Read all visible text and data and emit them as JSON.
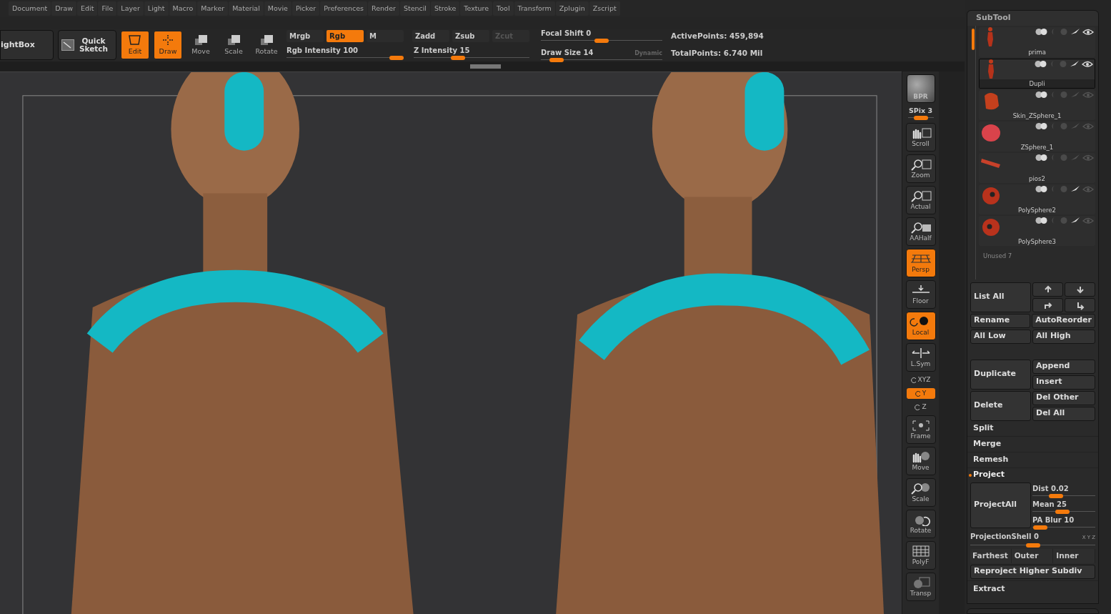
{
  "menu": [
    "Document",
    "Draw",
    "Edit",
    "File",
    "Layer",
    "Light",
    "Macro",
    "Marker",
    "Material",
    "Movie",
    "Picker",
    "Preferences",
    "Render",
    "Stencil",
    "Stroke",
    "Texture",
    "Tool",
    "Transform",
    "Zplugin",
    "Zscript"
  ],
  "toolbar": {
    "large_buttons": [
      {
        "label": "ightBox"
      },
      {
        "label": "Quick Sketch"
      }
    ],
    "modes": [
      {
        "label": "Edit",
        "selected": true
      },
      {
        "label": "Draw",
        "selected": true
      },
      {
        "label": "Move",
        "selected": false
      },
      {
        "label": "Scale",
        "selected": false
      },
      {
        "label": "Rotate",
        "selected": false
      }
    ],
    "color_modes": [
      {
        "label": "Mrgb",
        "selected": false
      },
      {
        "label": "Rgb",
        "selected": true
      },
      {
        "label": "M",
        "selected": false
      }
    ],
    "z_modes": [
      {
        "label": "Zadd",
        "selected": false,
        "disabled": false
      },
      {
        "label": "Zsub",
        "selected": false,
        "disabled": false
      },
      {
        "label": "Zcut",
        "selected": false,
        "disabled": true
      }
    ],
    "sliders": [
      {
        "label": "Rgb Intensity",
        "value": "100",
        "level": 0.95
      },
      {
        "label": "Z Intensity",
        "value": "15",
        "level": 0.38
      },
      {
        "label": "Focal Shift",
        "value": "0",
        "level": 0.5
      },
      {
        "label": "Draw Size",
        "value": "14",
        "level": 0.13
      }
    ],
    "dynamic": "Dynamic",
    "stats": [
      {
        "label": "ActivePoints:",
        "value": "459,894"
      },
      {
        "label": "TotalPoints:",
        "value": "6.740 Mil"
      }
    ]
  },
  "shelf": [
    {
      "kind": "bpr",
      "label": "BPR",
      "selected": false
    },
    {
      "kind": "slider",
      "label": "SPix",
      "value": "3",
      "level": 0.5
    },
    {
      "kind": "button",
      "label": "Scroll",
      "selected": false
    },
    {
      "kind": "button",
      "label": "Zoom",
      "selected": false
    },
    {
      "kind": "button",
      "label": "Actual",
      "selected": false
    },
    {
      "kind": "button",
      "label": "AAHalf",
      "selected": false
    },
    {
      "kind": "button",
      "label": "Persp",
      "selected": true
    },
    {
      "kind": "button",
      "label": "Floor",
      "selected": false
    },
    {
      "kind": "button",
      "label": "Local",
      "selected": true
    },
    {
      "kind": "button",
      "label": "L.Sym",
      "selected": false
    },
    {
      "kind": "small",
      "label": "XYZ",
      "selected": false
    },
    {
      "kind": "small",
      "label": "Y",
      "selected": true
    },
    {
      "kind": "small",
      "label": "Z",
      "selected": false
    },
    {
      "kind": "button",
      "label": "Frame",
      "selected": false
    },
    {
      "kind": "button",
      "label": "Move",
      "selected": false
    },
    {
      "kind": "button",
      "label": "Scale",
      "selected": false
    },
    {
      "kind": "button",
      "label": "Rotate",
      "selected": false
    },
    {
      "kind": "button",
      "label": "PolyF",
      "selected": false
    },
    {
      "kind": "button",
      "label": "Transp",
      "selected": false
    }
  ],
  "subtool": {
    "title": "SubTool",
    "items": [
      {
        "name": "prima",
        "selected": false,
        "visible": true,
        "polypaint": true
      },
      {
        "name": "Dupli",
        "selected": true,
        "visible": true,
        "polypaint": true
      },
      {
        "name": "Skin_ZSphere_1",
        "selected": false,
        "visible": false,
        "polypaint": false
      },
      {
        "name": "ZSphere_1",
        "selected": false,
        "visible": false,
        "polypaint": false
      },
      {
        "name": "pios2",
        "selected": false,
        "visible": false,
        "polypaint": false
      },
      {
        "name": "PolySphere2",
        "selected": false,
        "visible": false,
        "polypaint": true
      },
      {
        "name": "PolySphere3",
        "selected": false,
        "visible": false,
        "polypaint": true
      }
    ],
    "unused": "Unused 7",
    "list_all": "List All",
    "pairs": [
      [
        "Rename",
        "AutoReorder"
      ],
      [
        "All Low",
        "All High"
      ]
    ],
    "big_groups": [
      {
        "label": "Duplicate",
        "options": [
          "Append",
          "Insert"
        ]
      },
      {
        "label": "Delete",
        "options": [
          "Del Other",
          "Del All"
        ]
      }
    ],
    "sections": [
      "Split",
      "Merge",
      "Remesh"
    ],
    "project": {
      "title": "Project",
      "expanded": true,
      "button": "ProjectAll",
      "sliders": [
        {
          "label": "Dist",
          "value": "0.02",
          "level": 0.38
        },
        {
          "label": "Mean",
          "value": "25",
          "level": 0.48
        },
        {
          "label": "PA Blur",
          "value": "10",
          "level": 0.13
        }
      ],
      "shell": {
        "label": "ProjectionShell",
        "value": "0",
        "level": 0.5
      },
      "axes": "X Y Z",
      "options": [
        "Farthest",
        "Outer",
        "Inner"
      ],
      "reproject": "Reproject Higher Subdiv"
    },
    "extract": "Extract"
  }
}
